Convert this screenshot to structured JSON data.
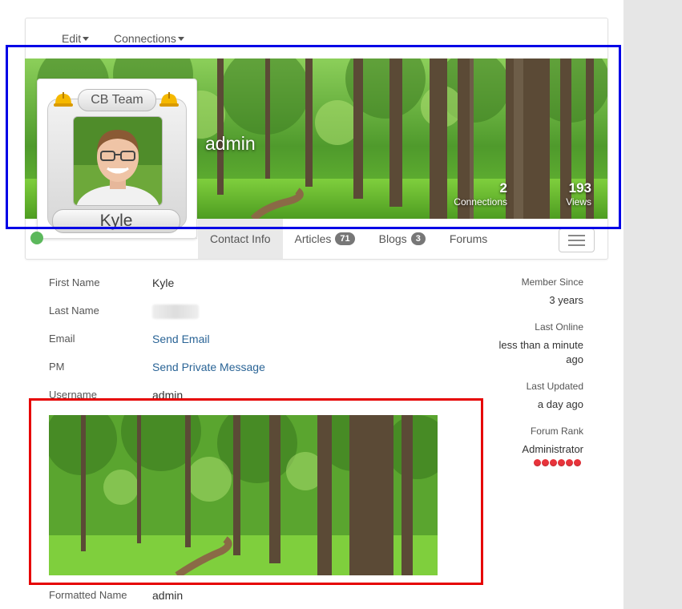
{
  "toolbar": {
    "edit_label": "Edit",
    "connections_label": "Connections"
  },
  "profile": {
    "display_name": "admin",
    "team_badge": "CB Team",
    "avatar_name": "Kyle",
    "stats": [
      {
        "value": "2",
        "label": "Connections"
      },
      {
        "value": "193",
        "label": "Views"
      }
    ]
  },
  "tabs": [
    {
      "label": "Contact Info",
      "badge": ""
    },
    {
      "label": "Articles",
      "badge": "71"
    },
    {
      "label": "Blogs",
      "badge": "3"
    },
    {
      "label": "Forums",
      "badge": ""
    }
  ],
  "fields": [
    {
      "label": "First Name",
      "value": "Kyle"
    },
    {
      "label": "Last Name",
      "value": ""
    },
    {
      "label": "Email",
      "value": "Send Email"
    },
    {
      "label": "PM",
      "value": "Send Private Message"
    },
    {
      "label": "Username",
      "value": "admin"
    },
    {
      "label": "Formatted Name",
      "value": "admin"
    }
  ],
  "sidebar": {
    "member_since_label": "Member Since",
    "member_since_value": "3 years",
    "last_online_label": "Last Online",
    "last_online_value_1": "less than a minute",
    "last_online_value_2": "ago",
    "last_updated_label": "Last Updated",
    "last_updated_value": "a day ago",
    "forum_rank_label": "Forum Rank",
    "forum_rank_value": "Administrator",
    "rank_stars": 6
  },
  "colors": {
    "link": "#2a6496",
    "online": "#5cb85c",
    "highlight_blue": "#0000e6",
    "highlight_red": "#e60000",
    "rank_star": "#e8333b"
  }
}
